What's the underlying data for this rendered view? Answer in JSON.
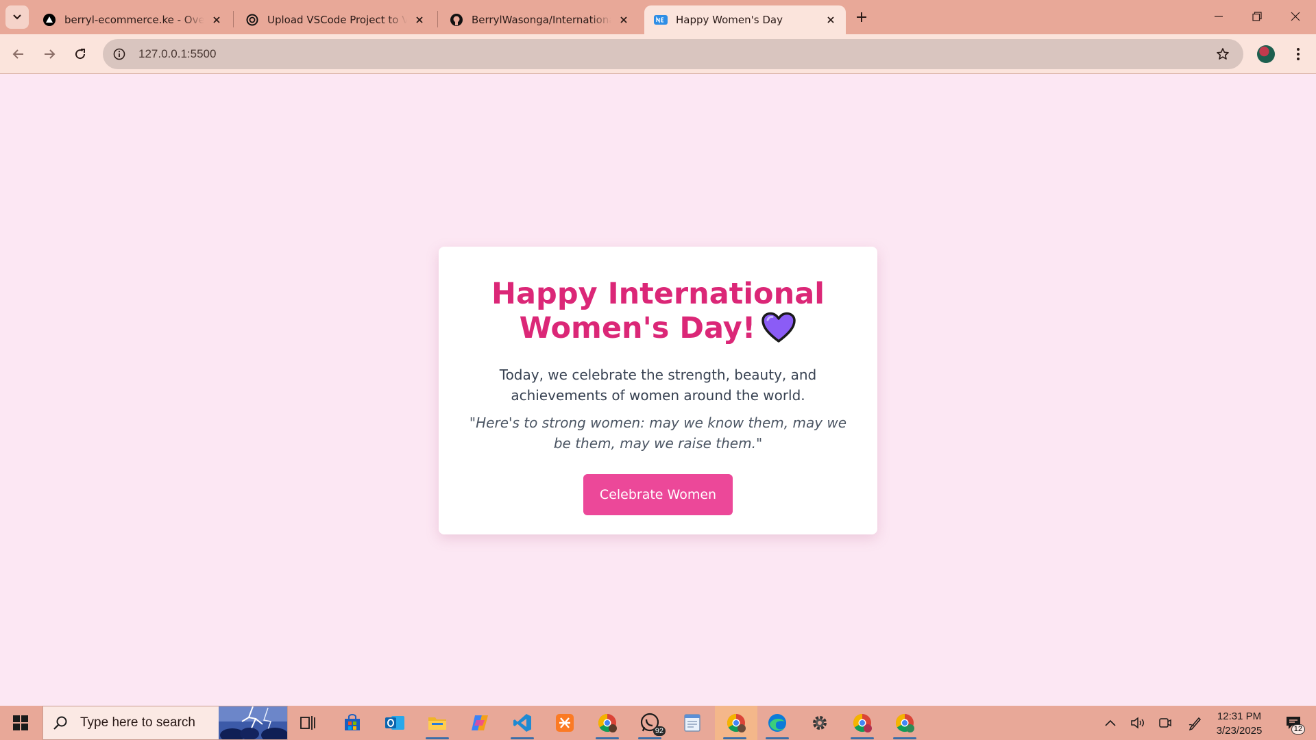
{
  "browser": {
    "tabs": [
      {
        "title": "berryl-ecommerce.ke - Overview",
        "favicon": "vercel-triangle-icon",
        "active": false
      },
      {
        "title": "Upload VSCode Project to Vercel",
        "favicon": "chatgpt-icon",
        "active": false
      },
      {
        "title": "BerrylWasonga/International-W",
        "favicon": "github-icon",
        "active": false
      },
      {
        "title": "Happy Women's Day",
        "favicon": "new-badge-icon",
        "active": true
      }
    ],
    "address": "127.0.0.1:5500"
  },
  "page": {
    "heading": "Happy International Women's Day!",
    "heading_emoji": "purple-heart-icon",
    "intro": "Today, we celebrate the strength, beauty, and achievements of women around the world.",
    "quote": "\"Here's to strong women: may we know them, may we be them, may we raise them.\"",
    "cta_label": "Celebrate Women",
    "colors": {
      "background": "#fce7f3",
      "heading": "#db2777",
      "button": "#ec4899"
    }
  },
  "taskbar": {
    "search_placeholder": "Type here to search",
    "apps": [
      "task-view",
      "microsoft-store",
      "outlook",
      "file-explorer",
      "copilot",
      "vscode",
      "xampp",
      "chrome-profile",
      "whatsapp",
      "notepad",
      "chrome-active",
      "edge",
      "settings",
      "chrome",
      "chrome-profile-2"
    ],
    "whatsapp_badge": "92",
    "time": "12:31 PM",
    "date": "3/23/2025",
    "notifications": "12"
  }
}
